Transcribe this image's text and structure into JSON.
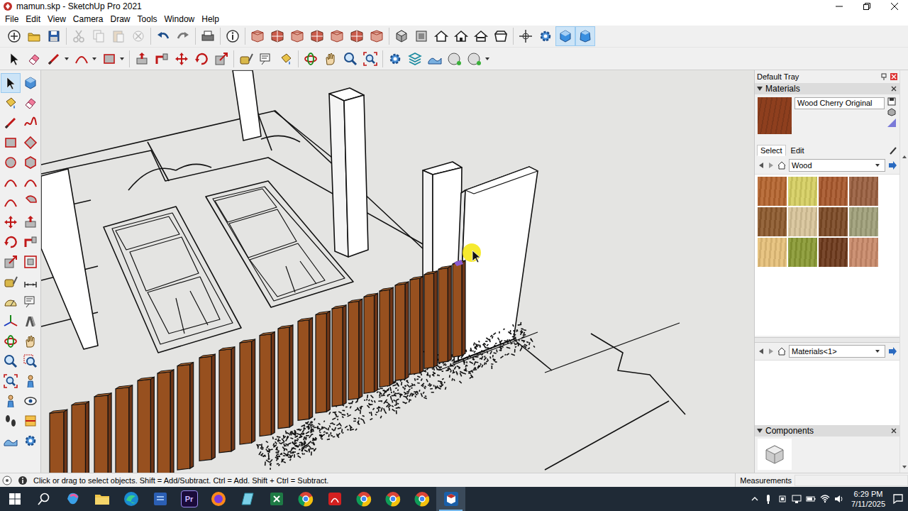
{
  "window": {
    "title": "mamun.skp - SketchUp Pro 2021"
  },
  "menu": [
    "File",
    "Edit",
    "View",
    "Camera",
    "Draw",
    "Tools",
    "Window",
    "Help"
  ],
  "toolbar_top": [
    {
      "selected": false,
      "disabled": false
    },
    {
      "selected": false,
      "disabled": false
    },
    {
      "selected": false,
      "disabled": false
    },
    {
      "selected": false,
      "disabled": true
    },
    {
      "selected": false,
      "disabled": true
    },
    {
      "selected": false,
      "disabled": true
    },
    {
      "selected": false,
      "disabled": true
    },
    {
      "selected": false,
      "disabled": false
    },
    {
      "selected": false,
      "disabled": false
    },
    {
      "selected": false,
      "disabled": false
    },
    {
      "selected": false,
      "disabled": false
    },
    {
      "selected": false,
      "disabled": false
    },
    {
      "selected": false,
      "disabled": false
    },
    {
      "selected": false,
      "disabled": false
    },
    {
      "selected": false,
      "disabled": false
    },
    {
      "selected": false,
      "disabled": false
    },
    {
      "selected": false,
      "disabled": false
    },
    {
      "selected": false,
      "disabled": false
    },
    {
      "selected": false,
      "disabled": false
    },
    {
      "selected": false,
      "disabled": false
    },
    {
      "selected": false,
      "disabled": false
    },
    {
      "selected": false,
      "disabled": false
    },
    {
      "selected": false,
      "disabled": false
    },
    {
      "selected": false,
      "disabled": false
    },
    {
      "selected": false,
      "disabled": false
    },
    {
      "selected": false,
      "disabled": false
    },
    {
      "selected": true,
      "disabled": false
    },
    {
      "selected": true,
      "disabled": false
    }
  ],
  "toolbar_second": [
    {
      "selected": false,
      "kind": "plain"
    },
    {
      "selected": false,
      "kind": "plain"
    },
    {
      "selected": false,
      "kind": "split"
    },
    {
      "selected": false,
      "kind": "split"
    },
    {
      "selected": false,
      "kind": "split"
    },
    {
      "selected": false,
      "kind": "plain"
    },
    {
      "selected": false,
      "kind": "plain"
    },
    {
      "selected": false,
      "kind": "plain"
    },
    {
      "selected": false,
      "kind": "plain"
    },
    {
      "selected": false,
      "kind": "plain"
    },
    {
      "selected": false,
      "kind": "plain"
    },
    {
      "selected": false,
      "kind": "plain"
    },
    {
      "selected": false,
      "kind": "plain"
    },
    {
      "selected": false,
      "kind": "plain"
    },
    {
      "selected": false,
      "kind": "plain"
    },
    {
      "selected": false,
      "kind": "plain"
    },
    {
      "selected": false,
      "kind": "plain"
    },
    {
      "selected": false,
      "kind": "plain"
    },
    {
      "selected": false,
      "kind": "plain"
    },
    {
      "selected": false,
      "kind": "plain"
    },
    {
      "selected": false,
      "kind": "plain"
    },
    {
      "selected": false,
      "kind": "split"
    }
  ],
  "left_tools": [
    {
      "selected": true
    },
    {
      "selected": false
    },
    {
      "selected": false
    },
    {
      "selected": false
    },
    {
      "selected": false
    },
    {
      "selected": false
    },
    {
      "selected": false
    },
    {
      "selected": false
    },
    {
      "selected": false
    },
    {
      "selected": false
    },
    {
      "selected": false
    },
    {
      "selected": false
    },
    {
      "selected": false
    },
    {
      "selected": false
    },
    {
      "selected": false
    },
    {
      "selected": false
    },
    {
      "selected": false
    },
    {
      "selected": false
    },
    {
      "selected": false
    },
    {
      "selected": false
    },
    {
      "selected": false
    },
    {
      "selected": false
    },
    {
      "selected": false
    },
    {
      "selected": false
    },
    {
      "selected": false
    },
    {
      "selected": false
    },
    {
      "selected": false
    },
    {
      "selected": false
    },
    {
      "selected": false
    },
    {
      "selected": false
    },
    {
      "selected": false
    },
    {
      "selected": false
    },
    {
      "selected": false
    },
    {
      "selected": false
    },
    {
      "selected": false
    },
    {
      "selected": false
    },
    {
      "selected": false
    },
    {
      "selected": false
    }
  ],
  "tray": {
    "title": "Default Tray",
    "materials": {
      "header": "Materials",
      "current": {
        "name": "Wood Cherry Original",
        "color": "#8e3f1e"
      },
      "tabs": [
        {
          "label": "Select",
          "selected": true
        },
        {
          "label": "Edit",
          "selected": false
        }
      ],
      "library": "Wood",
      "swatches": [
        {
          "color": "#b5652f"
        },
        {
          "color": "#d6cf62"
        },
        {
          "color": "#a8582c"
        },
        {
          "color": "#9a6040"
        },
        {
          "color": "#8d5a2e"
        },
        {
          "color": "#d8c49a"
        },
        {
          "color": "#7c4a26"
        },
        {
          "color": "#a0a07a"
        },
        {
          "color": "#e6c07a"
        },
        {
          "color": "#8a9a34"
        },
        {
          "color": "#6e3a1c"
        },
        {
          "color": "#c98a6a"
        }
      ],
      "model_library": "Materials<1>"
    },
    "components": {
      "header": "Components"
    }
  },
  "status_bar": {
    "hint": "Click or drag to select objects. Shift = Add/Subtract. Ctrl = Add. Shift + Ctrl = Subtract.",
    "measurements_label": "Measurements"
  },
  "taskbar": {
    "apps": [
      {
        "active": false
      },
      {
        "active": false
      },
      {
        "active": false
      },
      {
        "active": false
      },
      {
        "active": false,
        "label": "Pr"
      },
      {
        "active": false
      },
      {
        "active": false
      },
      {
        "active": false
      },
      {
        "active": false
      },
      {
        "active": false
      },
      {
        "active": false
      },
      {
        "active": false
      },
      {
        "active": false
      },
      {
        "active": true
      }
    ],
    "time": "6:29 PM",
    "date": "7/11/2025"
  }
}
